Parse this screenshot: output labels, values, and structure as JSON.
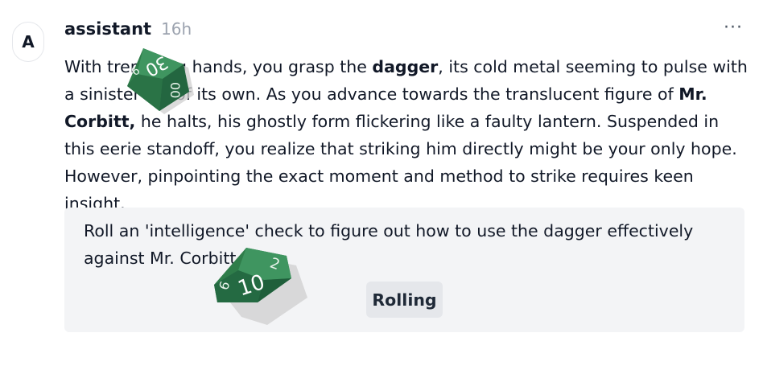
{
  "avatar": {
    "initial": "A"
  },
  "header": {
    "author": "assistant",
    "time": "16h",
    "more_label": "···"
  },
  "message": {
    "p1_a": "With trembling hands, you grasp the ",
    "p1_bold1": "dagger",
    "p1_b": ", its cold metal seeming to pulse with a sinister life of its own. As you advance towards the translucent figure of ",
    "p1_bold2": "Mr. Corbitt,",
    "p1_c": " he halts, his ghostly form flickering like a faulty lantern. Suspended in this eerie standoff, you realize that striking him directly might be your only hope. However, pinpointing the exact moment and method to strike requires keen insight."
  },
  "action": {
    "prompt": "Roll an 'intelligence' check to figure out how to use the dagger effectively against Mr. Corbitt.",
    "button_label": "Rolling"
  },
  "dice": {
    "die1": {
      "face_label": "30",
      "side_label": "00",
      "left_label": "6"
    },
    "die2": {
      "face_label": "10",
      "side_label": "2",
      "left_label": "6"
    },
    "color": "#2f7d4a"
  }
}
